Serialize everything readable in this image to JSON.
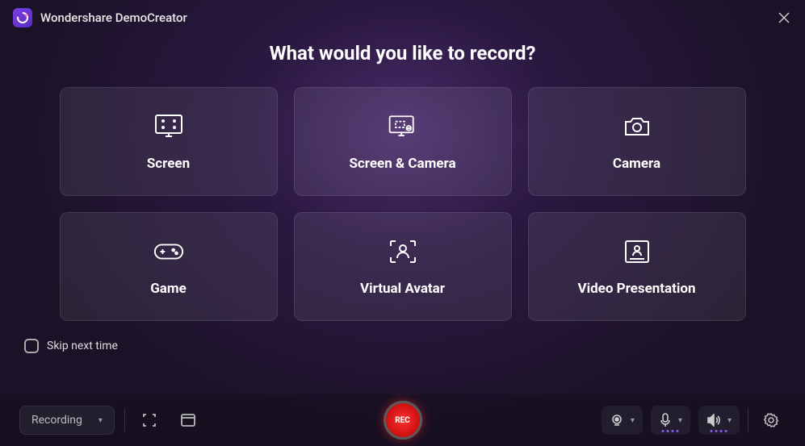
{
  "app": {
    "title": "Wondershare DemoCreator"
  },
  "heading": "What would you like to record?",
  "cards": [
    {
      "label": "Screen"
    },
    {
      "label": "Screen & Camera"
    },
    {
      "label": "Camera"
    },
    {
      "label": "Game"
    },
    {
      "label": "Virtual Avatar"
    },
    {
      "label": "Video Presentation"
    }
  ],
  "skip": {
    "label": "Skip next time",
    "checked": false
  },
  "bottombar": {
    "mode_label": "Recording",
    "rec_label": "REC"
  }
}
